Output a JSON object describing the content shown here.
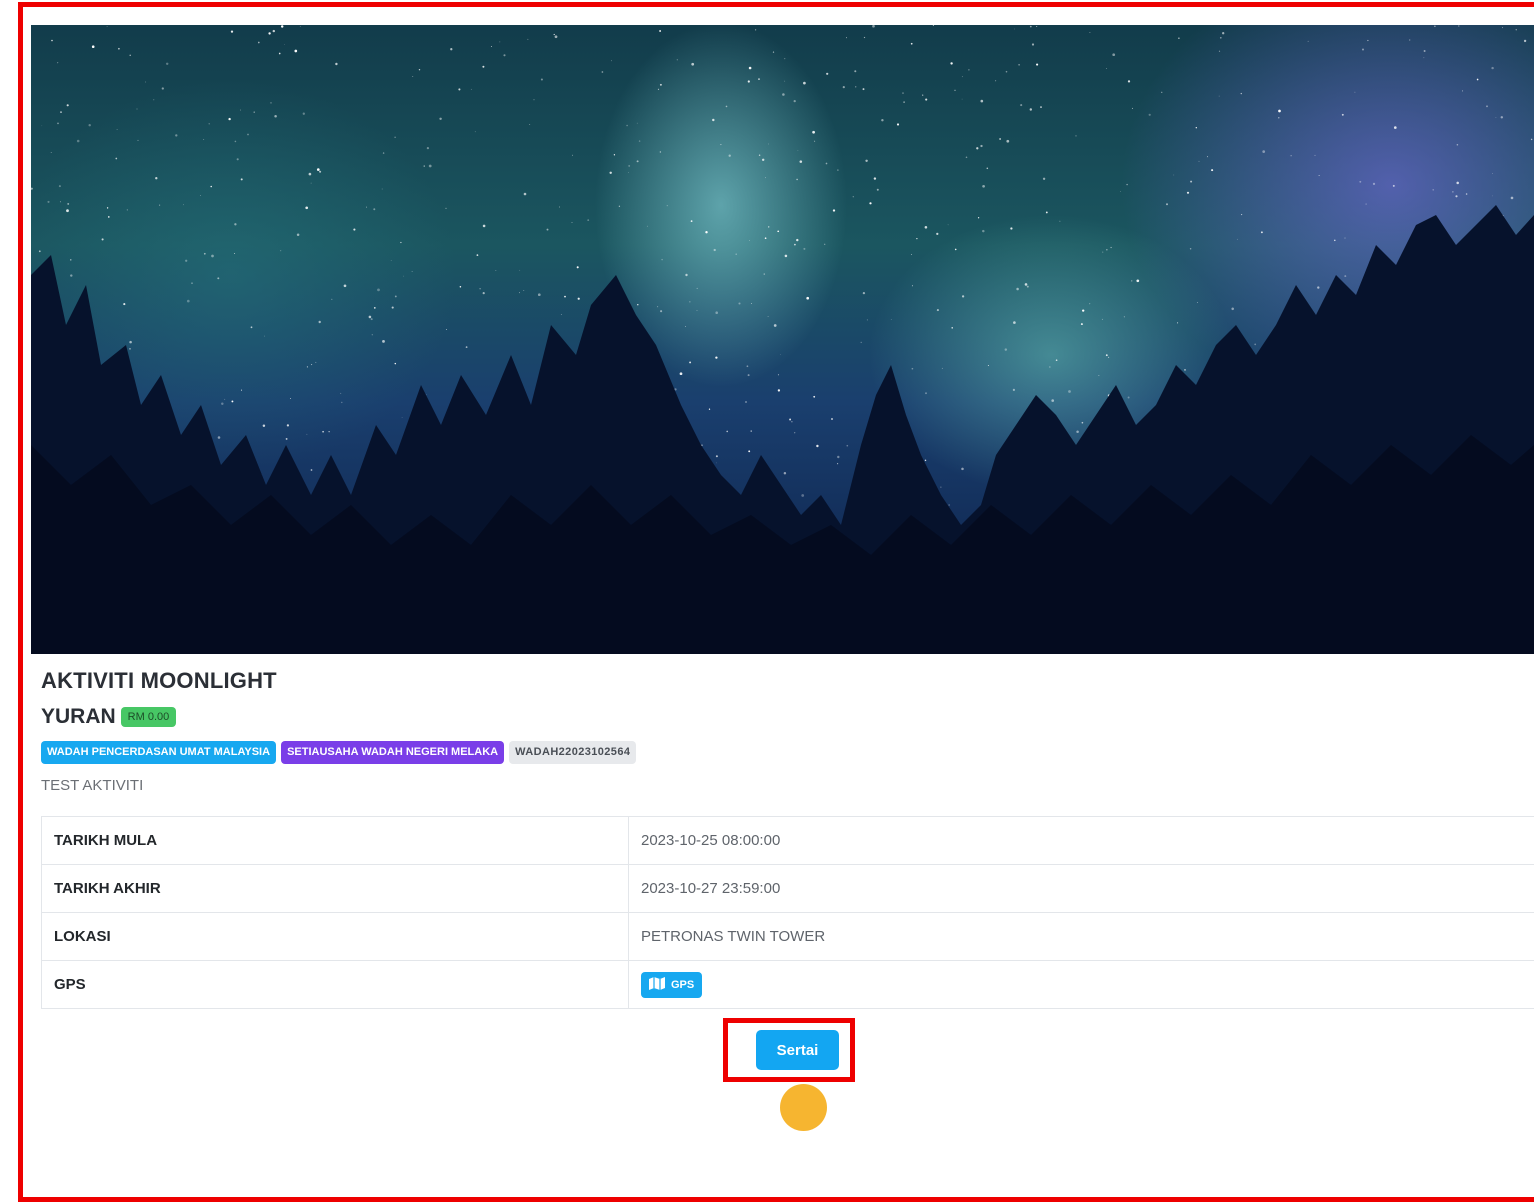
{
  "activity": {
    "title": "AKTIVITI MOONLIGHT",
    "fee_label": "YURAN",
    "fee_value": "RM 0.00",
    "tags": [
      "WADAH PENCERDASAN UMAT MALAYSIA",
      "SETIAUSAHA WADAH NEGERI MELAKA",
      "WADAH22023102564"
    ],
    "description": "TEST AKTIVITI"
  },
  "details": {
    "rows": [
      {
        "label": "TARIKH MULA",
        "value": "2023-10-25 08:00:00"
      },
      {
        "label": "TARIKH AKHIR",
        "value": "2023-10-27 23:59:00"
      },
      {
        "label": "LOKASI",
        "value": "PETRONAS TWIN TOWER"
      },
      {
        "label": "GPS",
        "value": ""
      }
    ],
    "gps_button_label": "GPS"
  },
  "actions": {
    "join_label": "Sertai"
  },
  "colors": {
    "highlight": "#ee0000",
    "primary": "#17a8f0",
    "purple": "#7a3ee8",
    "fee_green": "#47c765",
    "cursor": "#f6b530"
  },
  "icons": [
    "map-icon"
  ]
}
